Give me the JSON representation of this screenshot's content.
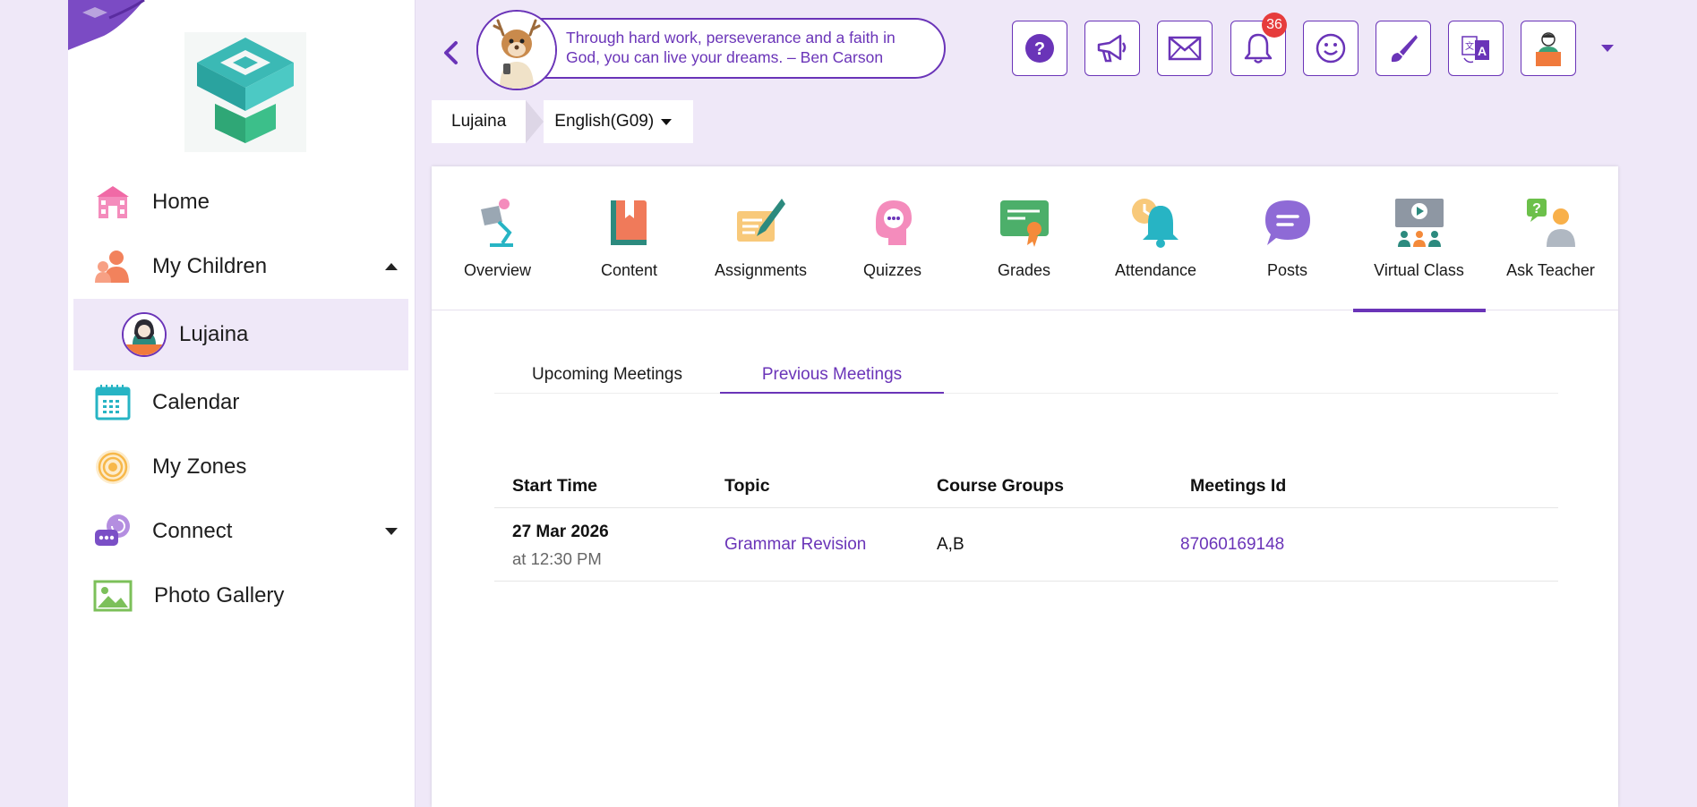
{
  "sidebar": {
    "items": [
      {
        "label": "Home",
        "icon": "school-building-icon"
      },
      {
        "label": "My Children",
        "icon": "parent-children-icon",
        "expanded": true
      },
      {
        "label": "Lujaina",
        "icon": "child-avatar-icon"
      },
      {
        "label": "Calendar",
        "icon": "calendar-icon"
      },
      {
        "label": "My Zones",
        "icon": "zones-icon"
      },
      {
        "label": "Connect",
        "icon": "chat-bubbles-icon",
        "expanded": false
      },
      {
        "label": "Photo Gallery",
        "icon": "image-icon"
      }
    ]
  },
  "header": {
    "quote": "Through hard work, perseverance and a faith in God, you can live your dreams. – Ben Carson",
    "notifications_count": "36",
    "buttons": [
      "help-icon",
      "megaphone-icon",
      "mail-icon",
      "bell-icon",
      "smiley-icon",
      "brush-icon",
      "translate-icon",
      "profile-avatar-icon"
    ]
  },
  "breadcrumb": {
    "child": "Lujaina",
    "course": "English(G09)"
  },
  "tabs": [
    {
      "label": "Overview"
    },
    {
      "label": "Content"
    },
    {
      "label": "Assignments"
    },
    {
      "label": "Quizzes"
    },
    {
      "label": "Grades"
    },
    {
      "label": "Attendance"
    },
    {
      "label": "Posts"
    },
    {
      "label": "Virtual Class",
      "active": true
    },
    {
      "label": "Ask Teacher"
    }
  ],
  "subtabs": {
    "upcoming": "Upcoming Meetings",
    "previous": "Previous Meetings",
    "active": "previous"
  },
  "table": {
    "headers": {
      "start_time": "Start Time",
      "topic": "Topic",
      "groups": "Course Groups",
      "meeting_id": "Meetings Id"
    },
    "rows": [
      {
        "date": "27 Mar 2026",
        "time": "at 12:30 PM",
        "topic": "Grammar Revision",
        "groups": "A,B",
        "meeting_id": "87060169148"
      }
    ]
  },
  "colors": {
    "accent": "#6a34b8",
    "background": "#efe8f8",
    "badge": "#e63c3c"
  }
}
